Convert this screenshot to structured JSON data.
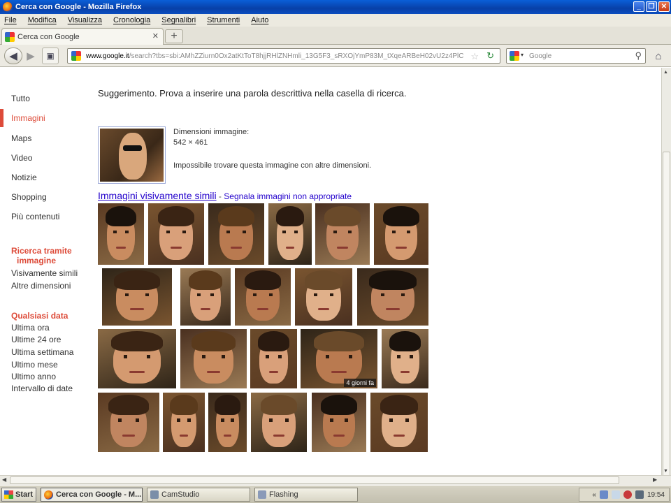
{
  "window": {
    "title": "Cerca con Google - Mozilla Firefox"
  },
  "menu": [
    "File",
    "Modifica",
    "Visualizza",
    "Cronologia",
    "Segnalibri",
    "Strumenti",
    "Aiuto"
  ],
  "tab": {
    "label": "Cerca con Google"
  },
  "nav": {
    "url_host": "www.google.it",
    "url_rest": "/search?tbs=sbi:AMhZZiurn0Ox2atKtToT8hjjRHlZNHmli_13G5F3_sRXOjYmP83M_tXqeARBeH02vU2z4PlC",
    "search_placeholder": "Google"
  },
  "sidebar": {
    "items": [
      {
        "label": "Tutto"
      },
      {
        "label": "Immagini",
        "active": true
      },
      {
        "label": "Maps"
      },
      {
        "label": "Video"
      },
      {
        "label": "Notizie"
      },
      {
        "label": "Shopping"
      },
      {
        "label": "Più contenuti"
      }
    ],
    "section_image": {
      "heading_line1": "Ricerca tramite",
      "heading_line2": "immagine",
      "items": [
        "Visivamente simili",
        "Altre dimensioni"
      ]
    },
    "section_date": {
      "heading": "Qualsiasi data",
      "items": [
        "Ultima ora",
        "Ultime 24 ore",
        "Ultima settimana",
        "Ultimo mese",
        "Ultimo anno",
        "Intervallo di date"
      ]
    }
  },
  "main": {
    "hint": "Suggerimento. Prova a inserire una parola descrittiva nella casella di ricerca.",
    "dimensions_label": "Dimensioni immagine:",
    "dimensions_value": "542 × 461",
    "no_sizes": "Impossibile trovare questa immagine con altre dimensioni.",
    "similar_link": "Immagini visivamente simili",
    "separator": " - ",
    "report_link": "Segnala immagini non appropriate",
    "badge": "4 giorni fa"
  },
  "taskbar": {
    "start": "Start",
    "items": [
      "Cerca con Google - M...",
      "CamStudio",
      "Flashing"
    ],
    "clock": "19:54"
  }
}
